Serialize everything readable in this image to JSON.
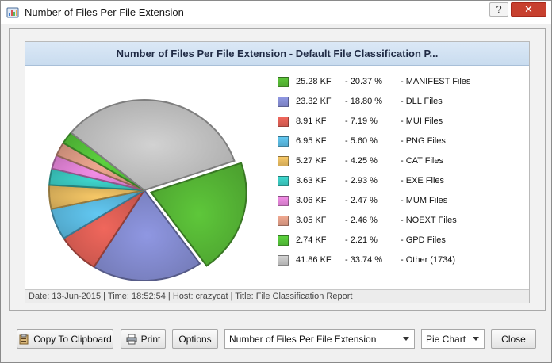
{
  "window": {
    "title": "Number of Files Per File Extension",
    "help_label": "?",
    "close_label": "✕"
  },
  "report": {
    "header": "Number of Files Per File Extension - Default File Classification P...",
    "footer": "Date: 13-Jun-2015 | Time: 18:52:54 | Host: crazycat | Title: File Classification Report"
  },
  "chart_data": {
    "type": "pie",
    "slices": [
      {
        "size": "25.28 KF",
        "pct_label": "- 20.37 %",
        "label": "- MANIFEST Files",
        "value": 20.37,
        "color": "#5ec73a"
      },
      {
        "size": "23.32 KF",
        "pct_label": "- 18.80 %",
        "label": "- DLL Files",
        "value": 18.8,
        "color": "#8f97e2"
      },
      {
        "size": "8.91 KF",
        "pct_label": "- 7.19 %",
        "label": "- MUI Files",
        "value": 7.19,
        "color": "#f0675c"
      },
      {
        "size": "6.95 KF",
        "pct_label": "- 5.60 %",
        "label": "- PNG Files",
        "value": 5.6,
        "color": "#62c8f2"
      },
      {
        "size": "5.27 KF",
        "pct_label": "- 4.25 %",
        "label": "- CAT Files",
        "value": 4.25,
        "color": "#f7c867"
      },
      {
        "size": "3.63 KF",
        "pct_label": "- 2.93 %",
        "label": "- EXE Files",
        "value": 2.93,
        "color": "#3fd8cf"
      },
      {
        "size": "3.06 KF",
        "pct_label": "- 2.47 %",
        "label": "- MUM Files",
        "value": 2.47,
        "color": "#f48ee8"
      },
      {
        "size": "3.05 KF",
        "pct_label": "- 2.46 %",
        "label": "- NOEXT Files",
        "value": 2.46,
        "color": "#f0a890"
      },
      {
        "size": "2.74 KF",
        "pct_label": "- 2.21 %",
        "label": "- GPD Files",
        "value": 2.21,
        "color": "#5cd23e"
      },
      {
        "size": "41.86 KF",
        "pct_label": "- 33.74 %",
        "label": "- Other (1734)",
        "value": 33.74,
        "color": "#d2d2d2"
      }
    ]
  },
  "toolbar": {
    "copy_label": "Copy To Clipboard",
    "print_label": "Print",
    "options_label": "Options",
    "report_select": "Number of Files Per File Extension",
    "chart_type_select": "Pie Chart",
    "close_label": "Close"
  }
}
